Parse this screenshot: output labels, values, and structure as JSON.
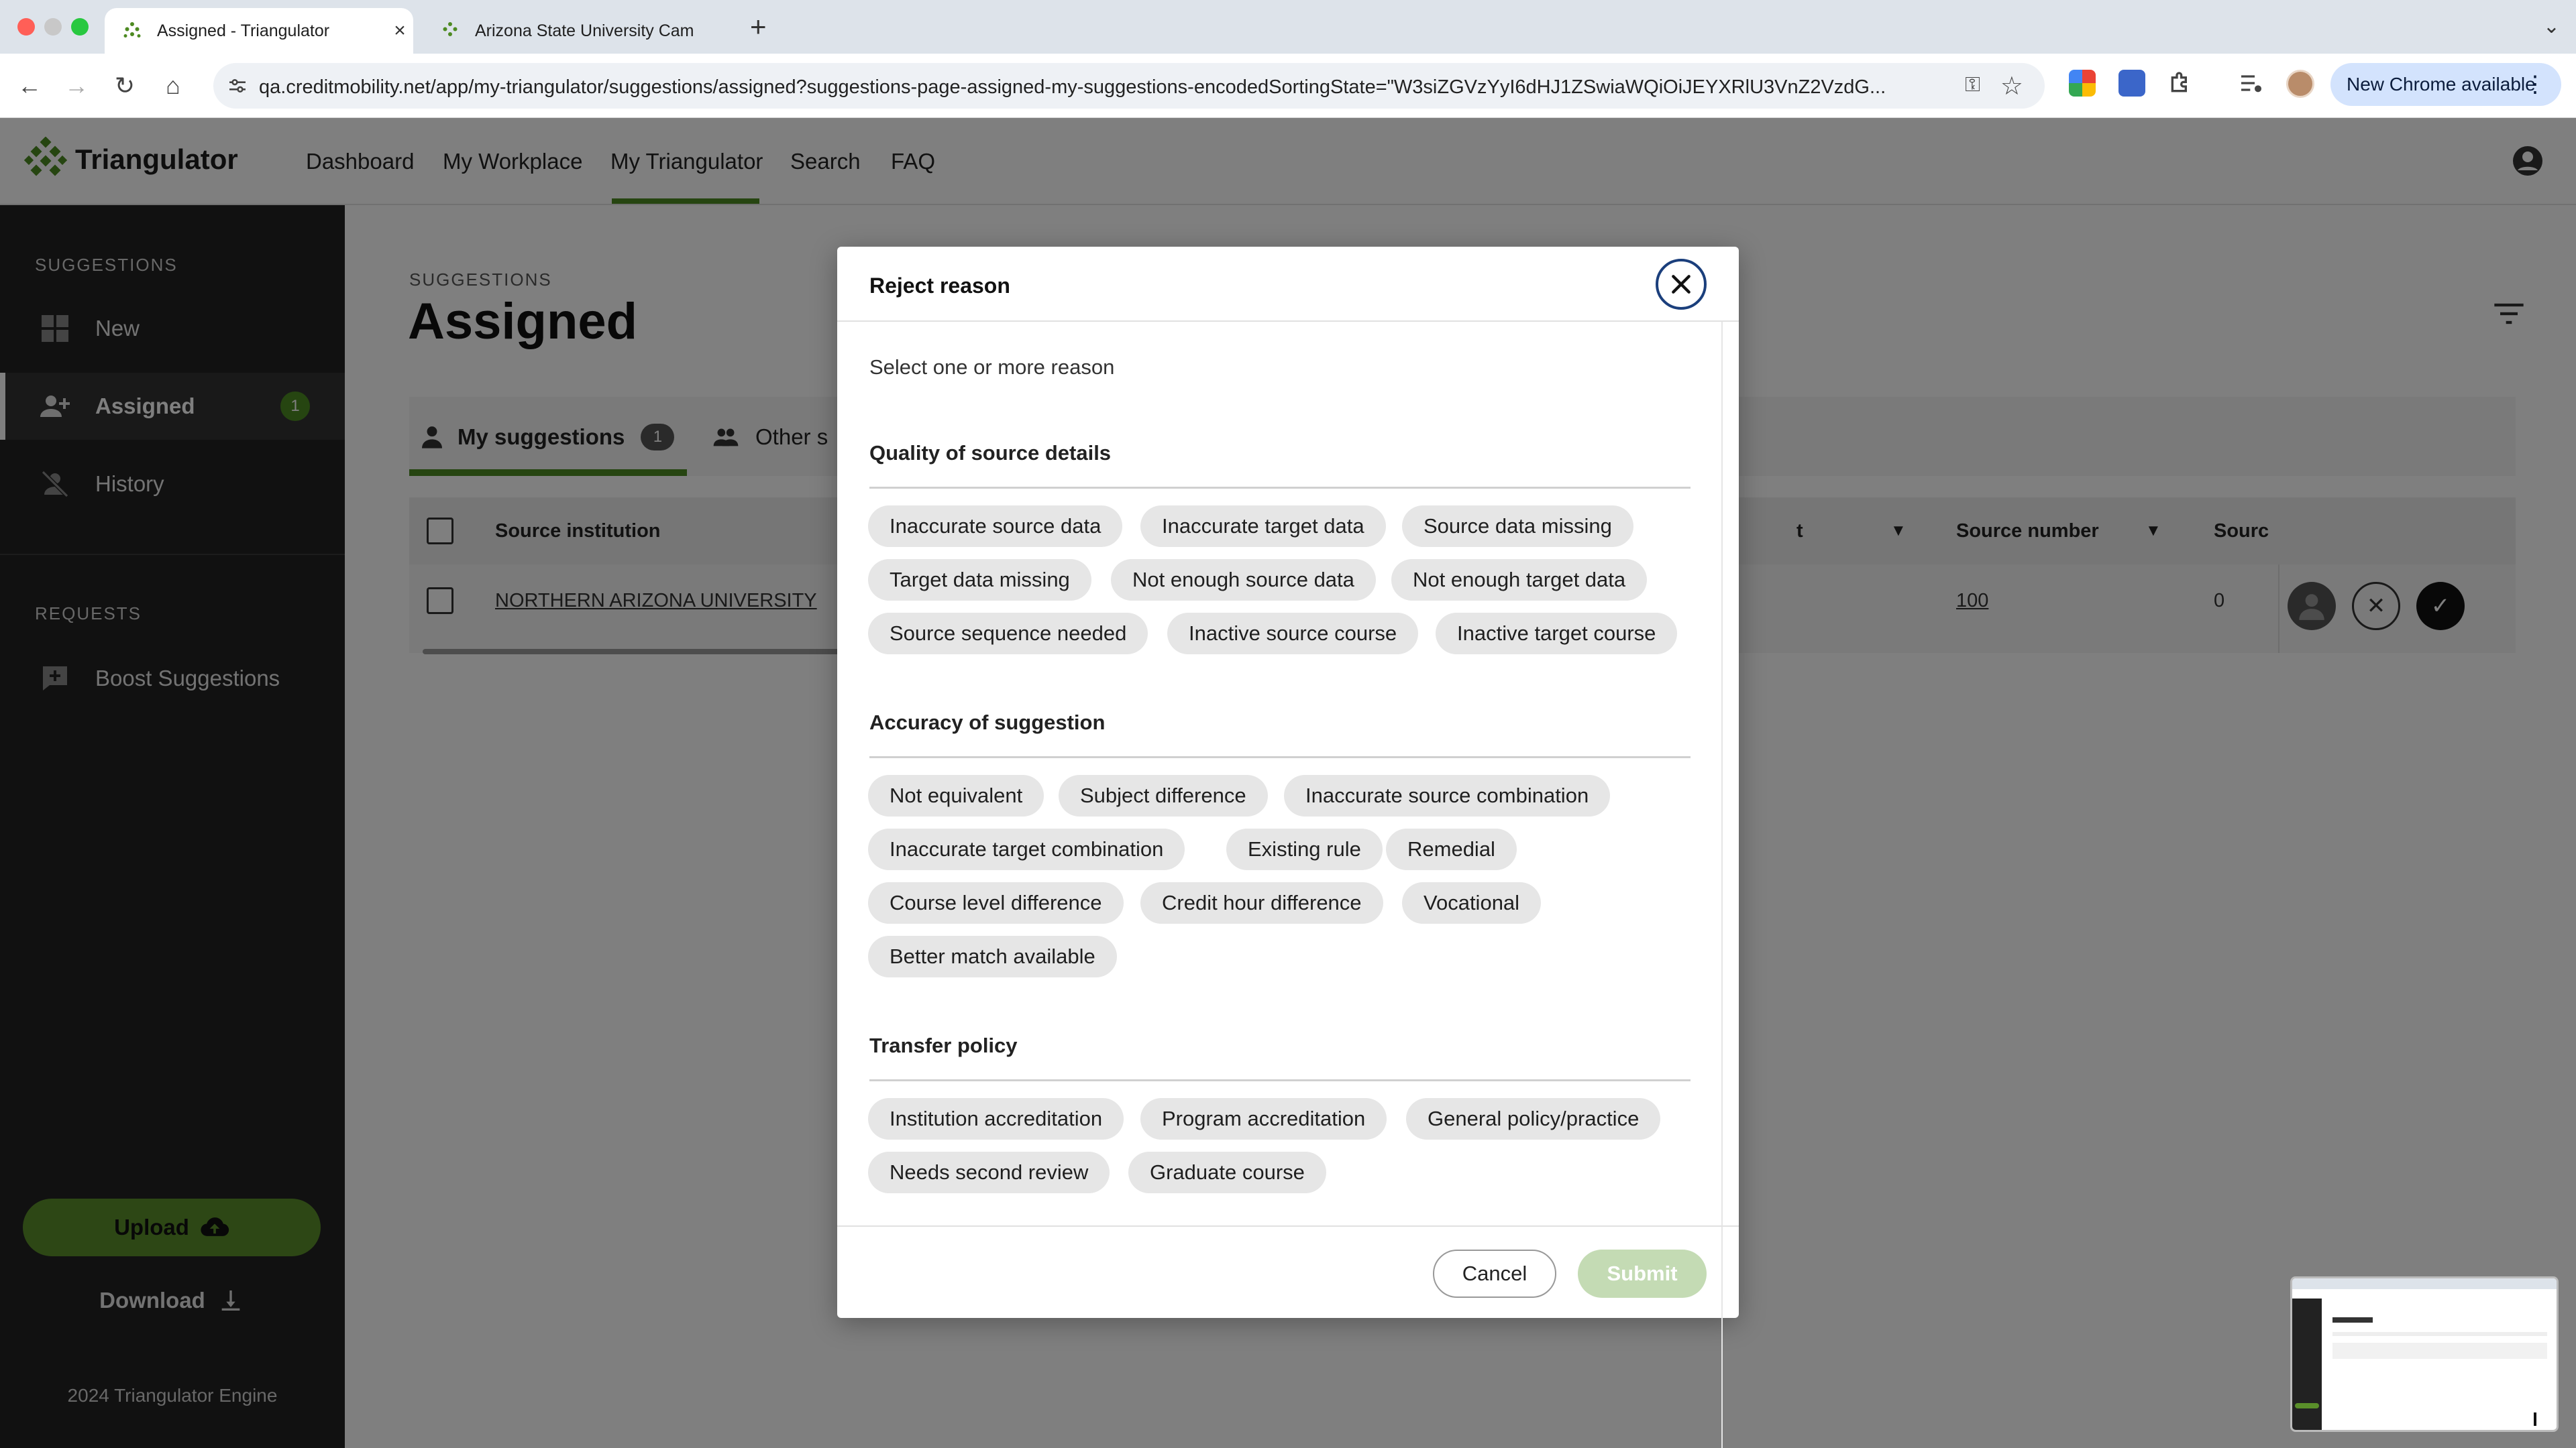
{
  "browser": {
    "tabs": [
      {
        "title": "Assigned - Triangulator",
        "active": true
      },
      {
        "title": "Arizona State University Cam",
        "active": false
      }
    ],
    "url": "qa.creditmobility.net/app/my-triangulator/suggestions/assigned?suggestions-page-assigned-my-suggestions-encodedSortingState=\"W3siZGVzYyI6dHJ1ZSwiaWQiOiJEYXRlU3VnZ2VzdG...",
    "update_label": "New Chrome available"
  },
  "app": {
    "brand": "Triangulator",
    "nav": [
      "Dashboard",
      "My Workplace",
      "My Triangulator",
      "Search",
      "FAQ"
    ],
    "active_nav": "My Triangulator"
  },
  "sidebar": {
    "section_suggestions": "SUGGESTIONS",
    "items": [
      {
        "label": "New",
        "icon": "grid-icon"
      },
      {
        "label": "Assigned",
        "icon": "person-add-icon",
        "badge": "1",
        "active": true
      },
      {
        "label": "History",
        "icon": "person-off-icon"
      }
    ],
    "section_requests": "REQUESTS",
    "requests": [
      {
        "label": "Boost Suggestions",
        "icon": "comment-plus-icon"
      }
    ],
    "upload_label": "Upload",
    "download_label": "Download",
    "copyright": "2024 Triangulator Engine"
  },
  "main": {
    "crumb": "SUGGESTIONS",
    "title": "Assigned",
    "tabs": [
      {
        "label": "My suggestions",
        "count": "1"
      },
      {
        "label": "Other s"
      }
    ],
    "table": {
      "headers": [
        "Source institution",
        "t",
        "Source number",
        "Sourc"
      ],
      "row": {
        "institution": "NORTHERN ARIZONA UNIVERSITY",
        "source_number": "100",
        "source_val": "0"
      }
    }
  },
  "modal": {
    "title": "Reject reason",
    "prompt": "Select one or more reason",
    "sections": [
      {
        "title": "Quality of source details",
        "chips": [
          "Inaccurate source data",
          "Inaccurate target data",
          "Source data missing",
          "Target data missing",
          "Not enough source data",
          "Not enough target data",
          "Source sequence needed",
          "Inactive source course",
          "Inactive target course"
        ]
      },
      {
        "title": "Accuracy of suggestion",
        "chips": [
          "Not equivalent",
          "Subject difference",
          "Inaccurate source combination",
          "Inaccurate target combination",
          "Existing rule",
          "Remedial",
          "Course level difference",
          "Credit hour difference",
          "Vocational",
          "Better match available"
        ]
      },
      {
        "title": "Transfer policy",
        "chips": [
          "Institution accreditation",
          "Program accreditation",
          "General policy/practice",
          "Needs second review",
          "Graduate course"
        ]
      }
    ],
    "cancel_label": "Cancel",
    "submit_label": "Submit"
  },
  "colors": {
    "accent_green": "#4d8a22",
    "sidebar_bg": "#222222",
    "close_ring": "#1b3f7c",
    "submit_disabled": "#c4dbb4"
  }
}
